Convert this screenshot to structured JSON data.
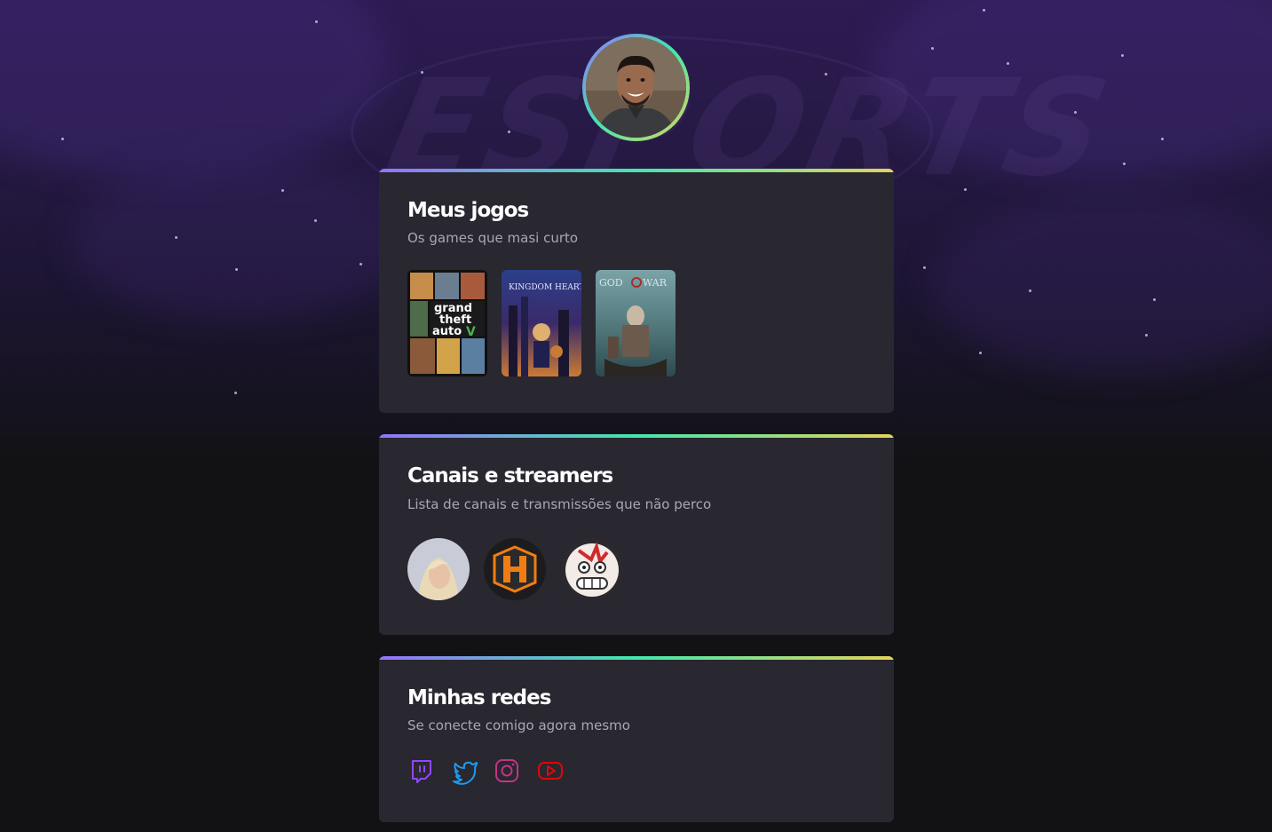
{
  "profile": {
    "avatar_alt": "Foto de perfil"
  },
  "colors": {
    "gradient_start": "#9572fc",
    "gradient_mid": "#43e7ad",
    "gradient_end": "#e2d45c",
    "card_bg": "#29272f",
    "page_bg": "#121214",
    "text_muted": "#a8a8b3"
  },
  "background": {
    "watermark": "ESPORTS"
  },
  "games_section": {
    "title": "Meus jogos",
    "subtitle": "Os games que masi curto",
    "games": [
      {
        "name": "Grand Theft Auto V",
        "icon": "gta-cover"
      },
      {
        "name": "Kingdom Hearts",
        "icon": "kingdom-hearts-cover"
      },
      {
        "name": "God of War",
        "icon": "god-of-war-cover"
      }
    ]
  },
  "channels_section": {
    "title": "Canais e streamers",
    "subtitle": "Lista de canais e transmissões que não perco",
    "channels": [
      {
        "icon": "streamer-avatar"
      },
      {
        "icon": "h-logo-avatar"
      },
      {
        "icon": "cartoon-face-avatar"
      }
    ]
  },
  "social_section": {
    "title": "Minhas redes",
    "subtitle": "Se conecte comigo agora mesmo",
    "links": [
      {
        "icon": "twitch-icon",
        "color": "#9146ff"
      },
      {
        "icon": "twitter-icon",
        "color": "#1d9bf0"
      },
      {
        "icon": "instagram-icon",
        "color": "#c13584"
      },
      {
        "icon": "youtube-icon",
        "color": "#e0070b"
      }
    ]
  }
}
